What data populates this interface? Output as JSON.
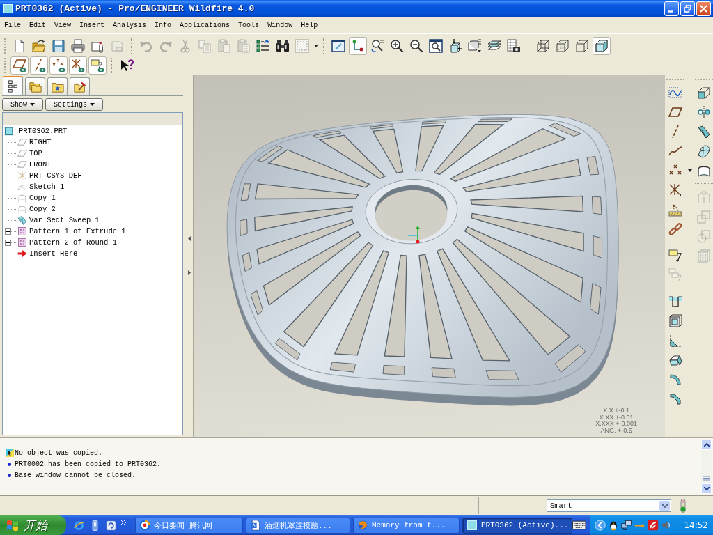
{
  "window": {
    "title": "PRT0362 (Active) - Pro/ENGINEER Wildfire 4.0"
  },
  "menu": [
    "File",
    "Edit",
    "View",
    "Insert",
    "Analysis",
    "Info",
    "Applications",
    "Tools",
    "Window",
    "Help"
  ],
  "toolbar_top": [
    {
      "items": [
        {
          "kind": "new",
          "selected": false,
          "disabled": false
        },
        {
          "kind": "open",
          "selected": false,
          "disabled": false
        },
        {
          "kind": "save",
          "selected": false,
          "disabled": false
        },
        {
          "kind": "print",
          "selected": false,
          "disabled": false
        },
        {
          "kind": "send",
          "selected": false,
          "disabled": false
        },
        {
          "kind": "device",
          "selected": false,
          "disabled": true
        }
      ]
    },
    {
      "items": [
        {
          "kind": "undo",
          "selected": false,
          "disabled": true
        },
        {
          "kind": "redo",
          "selected": false,
          "disabled": true
        },
        {
          "kind": "cut",
          "selected": false,
          "disabled": true
        },
        {
          "kind": "copy",
          "selected": false,
          "disabled": true
        },
        {
          "kind": "paste",
          "selected": false,
          "disabled": true
        },
        {
          "kind": "paste_special",
          "selected": false,
          "disabled": true
        },
        {
          "kind": "regenerate",
          "selected": false,
          "disabled": false
        },
        {
          "kind": "find",
          "selected": false,
          "disabled": false
        },
        {
          "kind": "select_box",
          "selected": false,
          "disabled": false
        }
      ]
    },
    {
      "items": [
        {
          "kind": "repaint",
          "selected": false,
          "disabled": false
        },
        {
          "kind": "spin_center",
          "selected": true,
          "disabled": false
        },
        {
          "kind": "orient",
          "selected": false,
          "disabled": false
        },
        {
          "kind": "zoom_in",
          "selected": false,
          "disabled": false
        },
        {
          "kind": "zoom_out",
          "selected": false,
          "disabled": false
        },
        {
          "kind": "refit",
          "selected": false,
          "disabled": false
        },
        {
          "kind": "reorient",
          "selected": false,
          "disabled": false
        },
        {
          "kind": "named_views",
          "selected": false,
          "disabled": false
        },
        {
          "kind": "layers",
          "selected": false,
          "disabled": false
        },
        {
          "kind": "view_manager",
          "selected": false,
          "disabled": false
        }
      ]
    },
    {
      "items": [
        {
          "kind": "wireframe",
          "selected": false,
          "disabled": false
        },
        {
          "kind": "hidden_line",
          "selected": false,
          "disabled": false
        },
        {
          "kind": "no_hidden",
          "selected": false,
          "disabled": false
        },
        {
          "kind": "shading",
          "selected": true,
          "disabled": false
        }
      ]
    }
  ],
  "toolbar_datum": [
    {
      "items": [
        {
          "kind": "plane_display",
          "selected": true,
          "disabled": false
        },
        {
          "kind": "axis_display",
          "selected": true,
          "disabled": false
        },
        {
          "kind": "point_display",
          "selected": true,
          "disabled": false
        },
        {
          "kind": "csys_display",
          "selected": true,
          "disabled": false
        },
        {
          "kind": "annotation_display",
          "selected": true,
          "disabled": false
        }
      ]
    },
    {
      "items": [
        {
          "kind": "whats_this",
          "selected": false,
          "disabled": false
        }
      ]
    }
  ],
  "model_tree": {
    "tabs": [
      {
        "kind": "tree",
        "selected": true
      },
      {
        "kind": "folders",
        "selected": false
      },
      {
        "kind": "favorites",
        "selected": false
      },
      {
        "kind": "tools",
        "selected": false
      }
    ],
    "menus": [
      "Show",
      "Settings"
    ],
    "root": {
      "label": "PRT0362.PRT",
      "kind": "part",
      "children": [
        {
          "label": "RIGHT",
          "kind": "plane"
        },
        {
          "label": "TOP",
          "kind": "plane"
        },
        {
          "label": "FRONT",
          "kind": "plane"
        },
        {
          "label": "PRT_CSYS_DEF",
          "kind": "csys"
        },
        {
          "label": "Sketch 1",
          "kind": "sketch"
        },
        {
          "label": "Copy 1",
          "kind": "copy"
        },
        {
          "label": "Copy 2",
          "kind": "copy"
        },
        {
          "label": "Var Sect Sweep 1",
          "kind": "sweep"
        },
        {
          "label": "Pattern 1 of Extrude 1",
          "kind": "pattern",
          "expanded": false
        },
        {
          "label": "Pattern 2 of Round 1",
          "kind": "pattern",
          "expanded": false
        },
        {
          "label": "Insert Here",
          "kind": "insert"
        }
      ]
    }
  },
  "graphics": {
    "tolerances": [
      "X.X +-0.1",
      "X.XX +-0.01",
      "X.XXX +-0.001",
      "ANG. +-0.5"
    ]
  },
  "feature_toolbar": {
    "columns": [
      {
        "groups": [
          {
            "items": [
              {
                "kind": "sketch",
                "disabled": false
              },
              {
                "kind": "plane",
                "disabled": false
              },
              {
                "kind": "axis",
                "disabled": false
              },
              {
                "kind": "curve",
                "disabled": false
              },
              {
                "kind": "point",
                "disabled": false
              },
              {
                "kind": "csys",
                "disabled": false
              },
              {
                "kind": "analysis",
                "disabled": false
              },
              {
                "kind": "chain",
                "disabled": false
              }
            ]
          },
          {
            "items": [
              {
                "kind": "note",
                "disabled": false
              },
              {
                "kind": "note_stack",
                "disabled": true
              }
            ]
          },
          {
            "items": [
              {
                "kind": "hole",
                "disabled": false
              },
              {
                "kind": "shell",
                "disabled": false
              },
              {
                "kind": "rib",
                "disabled": false
              },
              {
                "kind": "draft",
                "disabled": false
              },
              {
                "kind": "round",
                "disabled": false
              },
              {
                "kind": "chamfer",
                "disabled": false
              }
            ]
          }
        ]
      },
      {
        "groups": [
          {
            "items": [
              {
                "kind": "extrude",
                "disabled": false
              },
              {
                "kind": "revolve",
                "disabled": false
              },
              {
                "kind": "sweep",
                "disabled": false
              },
              {
                "kind": "boundary",
                "disabled": false
              },
              {
                "kind": "style",
                "disabled": false
              }
            ]
          },
          {
            "items": [
              {
                "kind": "mirror",
                "disabled": true
              },
              {
                "kind": "merge",
                "disabled": true
              },
              {
                "kind": "trim",
                "disabled": true
              },
              {
                "kind": "pattern",
                "disabled": true
              }
            ]
          }
        ]
      }
    ]
  },
  "messages": [
    {
      "kind": "prompt",
      "text": "No object was copied."
    },
    {
      "kind": "info",
      "text": "PRT0002 has been copied to PRT0362."
    },
    {
      "kind": "info",
      "text": "Base window cannot be closed."
    }
  ],
  "status_bar": {
    "filter": "Smart"
  },
  "taskbar": {
    "start": "开始",
    "tasks": [
      {
        "kind": "news",
        "label": "今日要闻 腾讯网",
        "selected": false
      },
      {
        "kind": "doc",
        "label": "油烟机罩连模题...",
        "selected": false
      },
      {
        "kind": "browser",
        "label": "Memory from t...",
        "selected": false
      },
      {
        "kind": "part",
        "label": "PRT0362 (Active)...",
        "selected": true
      }
    ],
    "clock": "14:52"
  }
}
